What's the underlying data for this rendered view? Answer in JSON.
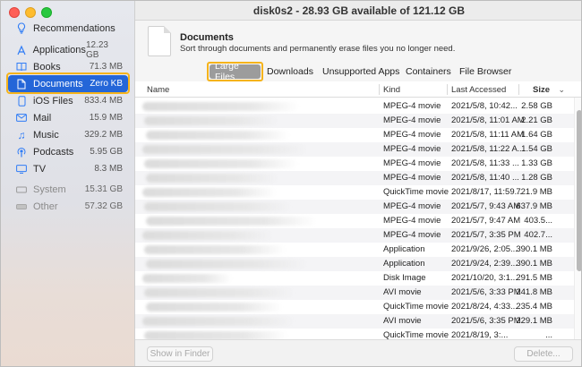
{
  "window": {
    "title": "disk0s2 - 28.93 GB available of 121.12 GB"
  },
  "sidebar": {
    "items": [
      {
        "label": "Recommendations",
        "size": "",
        "icon": "lightbulb-icon",
        "glyph": "💡"
      },
      {
        "label": "Applications",
        "size": "12.23 GB",
        "icon": "applications-icon",
        "glyph": "⚯"
      },
      {
        "label": "Books",
        "size": "71.3 MB",
        "icon": "book-icon",
        "glyph": "▥"
      },
      {
        "label": "Documents",
        "size": "Zero KB",
        "icon": "document-icon",
        "glyph": "▯"
      },
      {
        "label": "iOS Files",
        "size": "833.4 MB",
        "icon": "phone-icon",
        "glyph": "▯"
      },
      {
        "label": "Mail",
        "size": "15.9 MB",
        "icon": "envelope-icon",
        "glyph": "✉"
      },
      {
        "label": "Music",
        "size": "329.2 MB",
        "icon": "music-note-icon",
        "glyph": "♫"
      },
      {
        "label": "Podcasts",
        "size": "5.95 GB",
        "icon": "podcast-icon",
        "glyph": "◉"
      },
      {
        "label": "TV",
        "size": "8.3 MB",
        "icon": "tv-icon",
        "glyph": "▭"
      },
      {
        "label": "System",
        "size": "15.31 GB",
        "icon": "disk-icon",
        "glyph": "▭"
      },
      {
        "label": "Other",
        "size": "57.32 GB",
        "icon": "disk-icon",
        "glyph": "▬"
      }
    ],
    "highlight_color": "#f5b31b",
    "selected_color": "#2466d8"
  },
  "header": {
    "title": "Documents",
    "description": "Sort through documents and permanently erase files you no longer need."
  },
  "tabs": [
    {
      "label": "Large Files"
    },
    {
      "label": "Downloads"
    },
    {
      "label": "Unsupported Apps"
    },
    {
      "label": "Containers"
    },
    {
      "label": "File Browser"
    }
  ],
  "table": {
    "columns": {
      "name": "Name",
      "kind": "Kind",
      "last_accessed": "Last Accessed",
      "size": "Size"
    },
    "rows": [
      {
        "kind": "MPEG-4 movie",
        "date": "2021/5/8, 10:42...",
        "size": "2.58 GB"
      },
      {
        "kind": "MPEG-4 movie",
        "date": "2021/5/8, 11:01 AM",
        "size": "2.21 GB"
      },
      {
        "kind": "MPEG-4 movie",
        "date": "2021/5/8, 11:11 AM",
        "size": "1.64 GB"
      },
      {
        "kind": "MPEG-4 movie",
        "date": "2021/5/8, 11:22 A...",
        "size": "1.54 GB"
      },
      {
        "kind": "MPEG-4 movie",
        "date": "2021/5/8, 11:33 ...",
        "size": "1.33 GB"
      },
      {
        "kind": "MPEG-4 movie",
        "date": "2021/5/8, 11:40 ...",
        "size": "1.28 GB"
      },
      {
        "kind": "QuickTime movie",
        "date": "2021/8/17, 11:59...",
        "size": "721.9 MB"
      },
      {
        "kind": "MPEG-4 movie",
        "date": "2021/5/7, 9:43 AM",
        "size": "637.9 MB"
      },
      {
        "kind": "MPEG-4 movie",
        "date": "2021/5/7, 9:47 AM",
        "size": "403.5..."
      },
      {
        "kind": "MPEG-4 movie",
        "date": "2021/5/7, 3:35 PM",
        "size": "402.7..."
      },
      {
        "kind": "Application",
        "date": "2021/9/26, 2:05...",
        "size": "390.1 MB"
      },
      {
        "kind": "Application",
        "date": "2021/9/24, 2:39...",
        "size": "390.1 MB"
      },
      {
        "kind": "Disk Image",
        "date": "2021/10/20, 3:1...",
        "size": "291.5 MB"
      },
      {
        "kind": "AVI movie",
        "date": "2021/5/6, 3:33 PM",
        "size": "241.8 MB"
      },
      {
        "kind": "QuickTime movie",
        "date": "2021/8/24, 4:33...",
        "size": "235.4 MB"
      },
      {
        "kind": "AVI movie",
        "date": "2021/5/6, 3:35 PM",
        "size": "229.1 MB"
      },
      {
        "kind": "QuickTime movie",
        "date": "2021/8/19, 3:...",
        "size": "..."
      }
    ]
  },
  "footer": {
    "show_in_finder": "Show in Finder",
    "delete": "Delete..."
  }
}
